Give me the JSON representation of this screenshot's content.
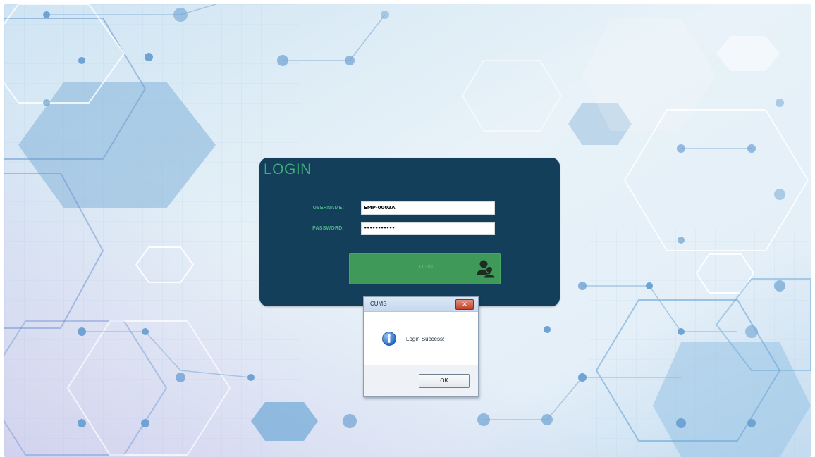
{
  "colors": {
    "panel_bg": "#143f5a",
    "title_color": "#3fae7c",
    "login_button": "#3f9a5a",
    "close_button": "#c0402a"
  },
  "login": {
    "title": "LOGIN",
    "username_label": "USERNAME:",
    "password_label": "PASSWORD:",
    "username_value": "EMP-0003A",
    "password_value": "•••••••••••",
    "button_label": "LOGIN",
    "button_icon": "users-icon"
  },
  "message_box": {
    "title": "CUMS",
    "icon": "info-icon",
    "message": "Login Success!",
    "ok_label": "OK",
    "close_label": "✕"
  }
}
